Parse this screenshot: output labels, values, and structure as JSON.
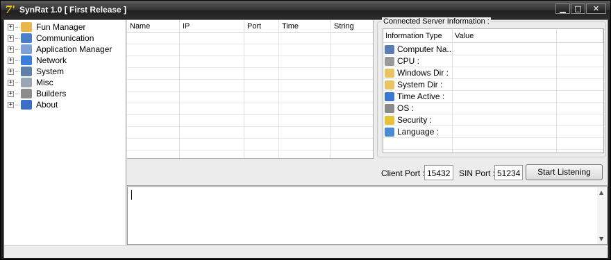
{
  "window": {
    "title": "SynRat 1.0 [ First Release ]",
    "icon_glyph": "7'"
  },
  "window_controls": {
    "minimize": "▁",
    "maximize": "□",
    "close": "✕"
  },
  "tree": {
    "items": [
      {
        "label": "Fun Manager",
        "icon": "folder-icon",
        "color": "#e8b64a"
      },
      {
        "label": "Communication",
        "icon": "people-icon",
        "color": "#4a7fc9"
      },
      {
        "label": "Application Manager",
        "icon": "window-icon",
        "color": "#7fa0d6"
      },
      {
        "label": "Network",
        "icon": "network-icon",
        "color": "#3b7dd8"
      },
      {
        "label": "System",
        "icon": "computer-icon",
        "color": "#5f7fa8"
      },
      {
        "label": "Misc",
        "icon": "misc-icon",
        "color": "#9aa6b4"
      },
      {
        "label": "Builders",
        "icon": "gear-icon",
        "color": "#8c8c8c"
      },
      {
        "label": "About",
        "icon": "info-icon",
        "color": "#3a6fc4"
      }
    ]
  },
  "clients_table": {
    "columns": [
      "Name",
      "IP",
      "Port",
      "Time",
      "String"
    ]
  },
  "server_info": {
    "legend": "Connected Server Information :",
    "columns": [
      "Information Type",
      "Value"
    ],
    "rows": [
      {
        "label": "Computer Na...",
        "icon": "monitor-icon",
        "color": "#5b7db5"
      },
      {
        "label": "CPU :",
        "icon": "cpu-icon",
        "color": "#9a9a9a"
      },
      {
        "label": "Windows Dir :",
        "icon": "folder-icon",
        "color": "#e8c560"
      },
      {
        "label": "System Dir :",
        "icon": "folder-icon",
        "color": "#e8c560"
      },
      {
        "label": "Time Active :",
        "icon": "clock-icon",
        "color": "#3a78d0"
      },
      {
        "label": "OS :",
        "icon": "drive-icon",
        "color": "#8a8a8a"
      },
      {
        "label": "Security :",
        "icon": "shield-icon",
        "color": "#e6c23a"
      },
      {
        "label": "Language :",
        "icon": "flag-icon",
        "color": "#4a8ad6"
      }
    ]
  },
  "ports": {
    "client_label": "Client Port :",
    "client_value": "15432",
    "sin_label": "SIN Port :",
    "sin_value": "51234",
    "listen_button": "Start Listening"
  },
  "log": {
    "text": ""
  }
}
